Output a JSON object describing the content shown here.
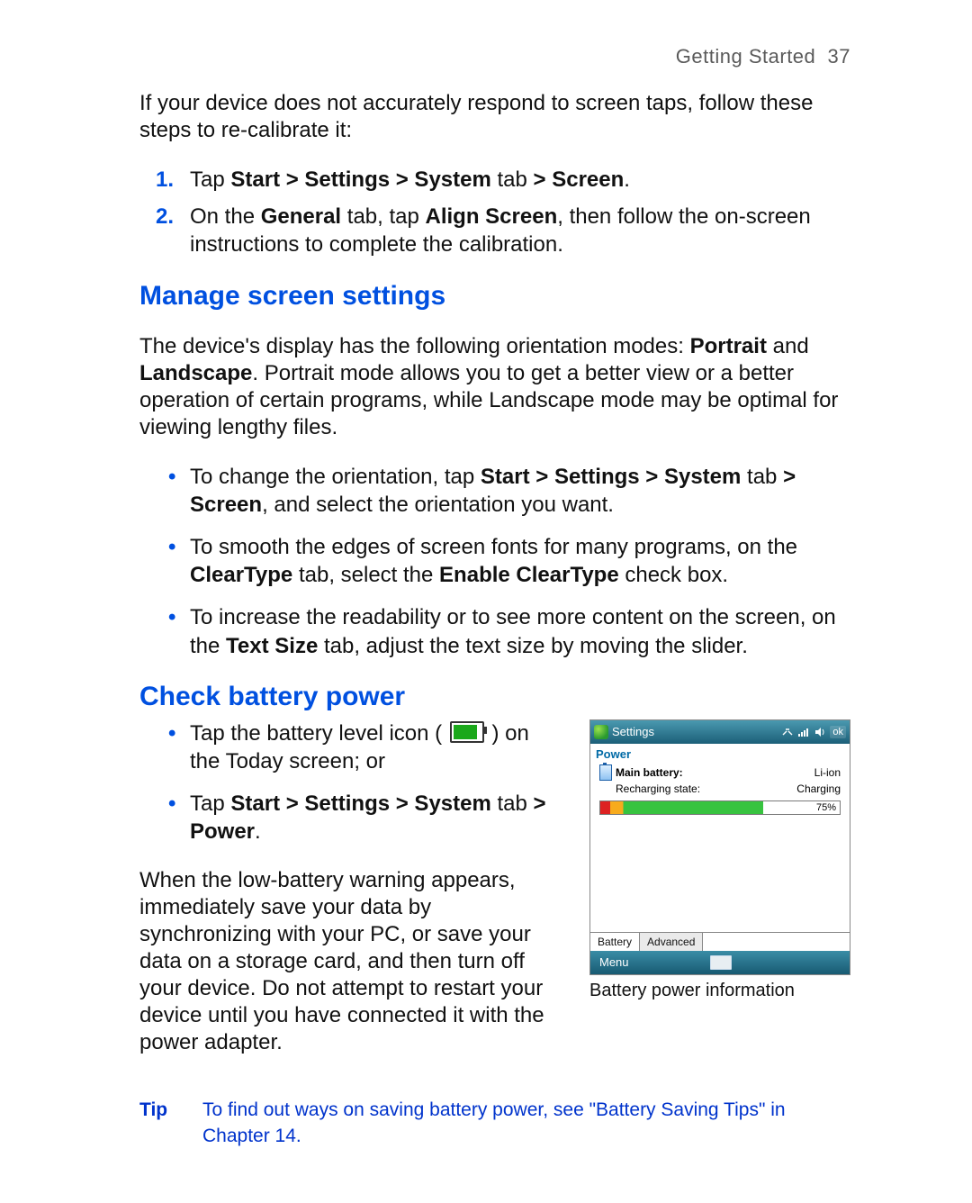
{
  "header": {
    "section": "Getting Started",
    "page": "37"
  },
  "intro": "If your device does not accurately respond to screen taps, follow these steps to re-calibrate it:",
  "steps": [
    {
      "num": "1.",
      "pre": "Tap ",
      "bold": "Start > Settings > System",
      "mid": " tab ",
      "bold2": "> Screen",
      "post": "."
    },
    {
      "num": "2.",
      "pre": "On the ",
      "bold": "General",
      "mid": " tab, tap ",
      "bold2": "Align Screen",
      "post": ", then follow the on-screen instructions to complete the calibration."
    }
  ],
  "manage": {
    "title": "Manage screen settings",
    "para_pre": "The device's display has the following orientation modes: ",
    "para_b1": "Portrait",
    "para_mid": " and ",
    "para_b2": "Landscape",
    "para_post": ". Portrait mode allows you to get a better view or a better operation of certain programs, while Landscape mode may be optimal for viewing lengthy files.",
    "bullets": [
      {
        "pre": "To change the orientation, tap ",
        "b1": "Start > Settings > System",
        "mid1": " tab ",
        "b2": "> Screen",
        "mid2": ", and select the orientation you want.",
        "b3": "",
        "mid3": "",
        "b4": "",
        "post": ""
      },
      {
        "pre": "To smooth the edges of screen fonts for many programs, on the ",
        "b1": "ClearType",
        "mid1": " tab, select the ",
        "b2": "Enable ClearType",
        "mid2": " check box.",
        "b3": "",
        "mid3": "",
        "b4": "",
        "post": ""
      },
      {
        "pre": "To increase the readability or to see more content on the screen, on the ",
        "b1": "Text Size",
        "mid1": " tab, adjust the text size by moving the slider.",
        "b2": "",
        "mid2": "",
        "b3": "",
        "mid3": "",
        "b4": "",
        "post": ""
      }
    ]
  },
  "battery": {
    "title": "Check battery power",
    "bullets": [
      {
        "pre": "Tap the battery level icon (",
        "post": ") on the Today screen; or"
      },
      {
        "pre": "Tap ",
        "b1": "Start > Settings > System",
        "mid": " tab ",
        "b2": "> Power",
        "post": "."
      }
    ],
    "para": "When the low-battery warning appears, immediately save your data by synchronizing with your PC, or save your data on a storage card, and then turn off your device. Do not attempt to restart your device until you have connected it with the power adapter."
  },
  "screenshot": {
    "title": "Settings",
    "ok": "ok",
    "heading": "Power",
    "main_label": "Main battery:",
    "main_type": "Li-ion",
    "recharge_label": "Recharging state:",
    "recharge_value": "Charging",
    "percent": "75%",
    "progress_width": "68%",
    "tabs": {
      "battery": "Battery",
      "advanced": "Advanced"
    },
    "menu": "Menu",
    "caption": "Battery power information"
  },
  "tip": {
    "label": "Tip",
    "text": "To find out ways on saving battery power, see \"Battery Saving Tips\" in Chapter 14."
  }
}
